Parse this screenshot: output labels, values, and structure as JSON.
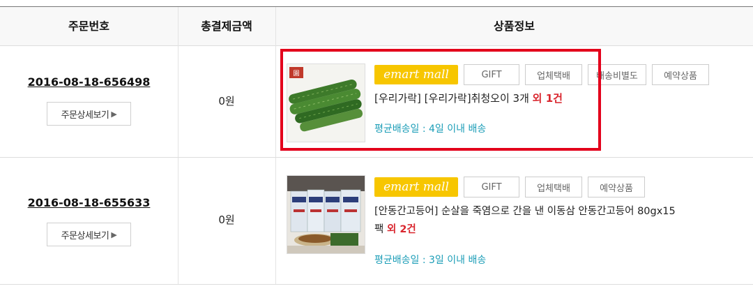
{
  "headers": {
    "order_no": "주문번호",
    "total": "총결제금액",
    "product": "상품정보"
  },
  "orders": [
    {
      "order_no": "2016-08-18-656498",
      "detail_button": "주문상세보기",
      "amount": "0원",
      "mall_badge": "emart mall",
      "tags": [
        "GIFT",
        "업체택배",
        "배송비별도",
        "예약상품"
      ],
      "title": "[우리가락] [우리가락]취청오이 3개",
      "more": "외 1건",
      "shipping": "평균배송일 : 4일 이내 배송",
      "thumb_label": "cucumbers"
    },
    {
      "order_no": "2016-08-18-655633",
      "detail_button": "주문상세보기",
      "amount": "0원",
      "mall_badge": "emart mall",
      "tags": [
        "GIFT",
        "업체택배",
        "예약상품"
      ],
      "title_line1": "[안동간고등어] 순살을 죽염으로 간을 낸 이동삼 안동간고등어 80gx15",
      "title_line2": "팩",
      "more": "외 2건",
      "shipping": "평균배송일 : 3일 이내 배송",
      "thumb_label": "mackerel packs"
    }
  ],
  "colors": {
    "emart_yellow": "#f7c600",
    "more_red": "#d9262e",
    "shipping_teal": "#1b9db7",
    "highlight_red": "#e3001b"
  }
}
